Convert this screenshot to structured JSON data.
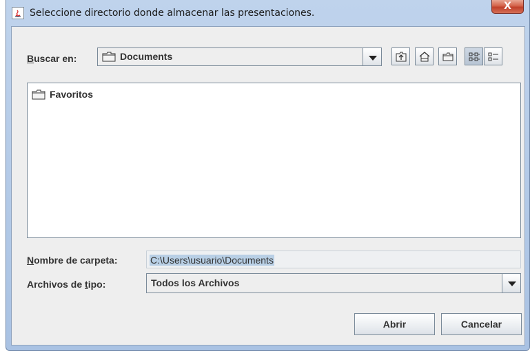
{
  "window": {
    "title": "Seleccione directorio donde almacenar las presentaciones.",
    "close_label": "X"
  },
  "look_in": {
    "label_mnemonic": "B",
    "label_rest": "uscar en:",
    "value": "Documents"
  },
  "toolbar": {
    "buttons": [
      {
        "icon": "up-one-level-icon"
      },
      {
        "icon": "home-icon"
      },
      {
        "icon": "new-folder-icon"
      },
      {
        "icon": "list-view-icon"
      },
      {
        "icon": "details-view-icon"
      }
    ]
  },
  "file_list": {
    "items": [
      {
        "label": "Favoritos",
        "icon": "folder-icon"
      }
    ]
  },
  "folder_name": {
    "label_mnemonic": "N",
    "label_rest": "ombre de carpeta:",
    "value": "C:\\Users\\usuario\\Documents"
  },
  "file_type": {
    "label_before": "Archivos de ",
    "label_mnemonic": "t",
    "label_after": "ipo:",
    "value": "Todos los Archivos"
  },
  "buttons": {
    "open_label": "Abrir",
    "cancel_label": "Cancelar"
  },
  "colors": {
    "title_bar": "#bfd3ec",
    "panel": "#eeeeee",
    "close_button": "#c0402a",
    "selection": "#b8cfe5"
  }
}
